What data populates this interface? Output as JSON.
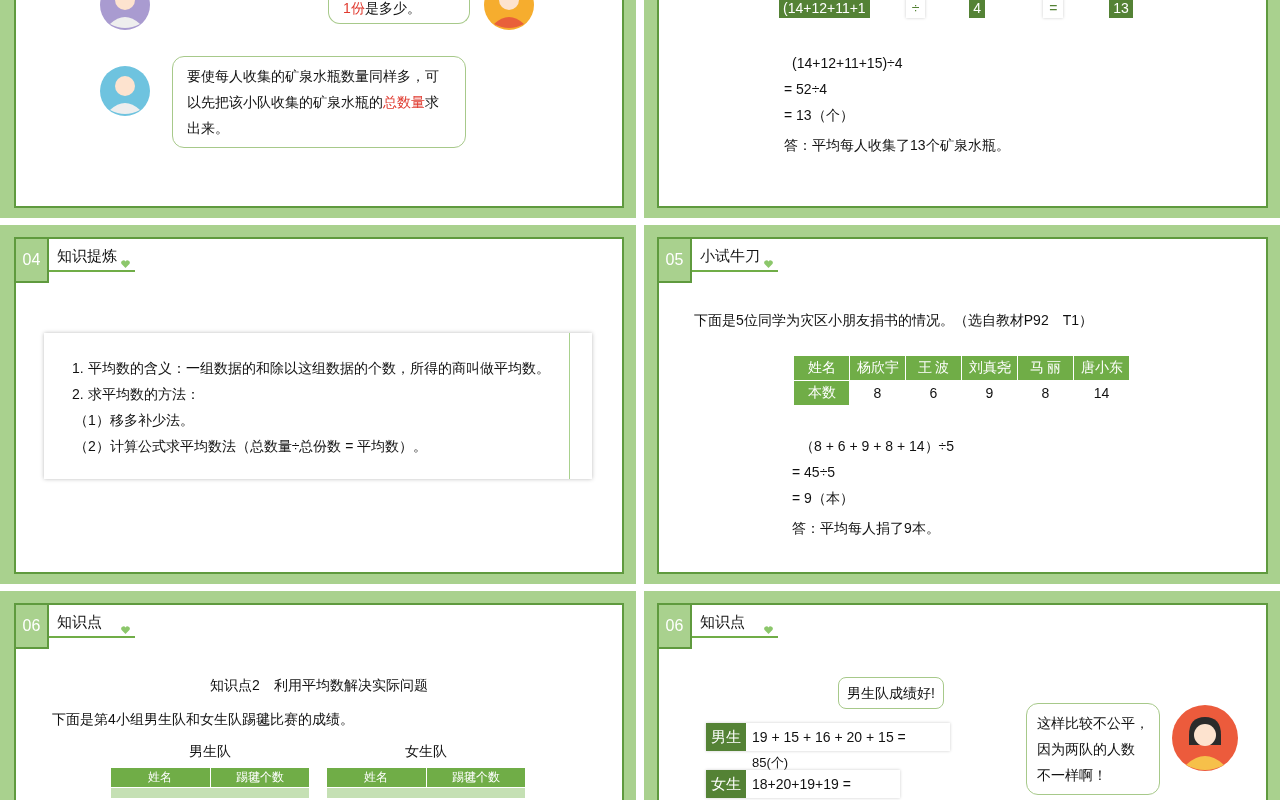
{
  "slides": [
    {
      "kind": "dialogue",
      "rows": [
        {
          "avatars": [
            {
              "kind": "girl-purple"
            },
            {
              "kind": "girl-orange"
            }
          ],
          "bubble": [
            {
              "text": "1份",
              "highlight": true
            },
            {
              "text": "是多少。",
              "highlight": false
            }
          ]
        },
        {
          "avatars": [
            {
              "kind": "boy-blue"
            }
          ],
          "bubble": [
            {
              "text": "要使每人收集的矿泉水瓶数量同样多，可以先把该小队收集的矿泉水瓶的",
              "highlight": false
            },
            {
              "text": "总数量",
              "highlight": true
            },
            {
              "text": "求出来。",
              "highlight": false
            }
          ]
        }
      ]
    },
    {
      "kind": "calculation",
      "blocks": [
        {
          "text": "(14+12+11+1",
          "kind": "filled"
        },
        {
          "text": "÷",
          "kind": "plain"
        },
        {
          "text": "4",
          "kind": "filled"
        },
        {
          "text": "=",
          "kind": "plain"
        },
        {
          "text": "13",
          "kind": "filled"
        }
      ],
      "lines": [
        "(14+12+11+15)÷4",
        "=  52÷4",
        "=  13（个）"
      ],
      "answer": "答：平均每人收集了13个矿泉水瓶。"
    },
    {
      "kind": "summary",
      "number": "04",
      "title": "知识提炼",
      "lines": [
        "1. 平均数的含义：一组数据的和除以这组数据的个数，所得的商叫做平均数。",
        "2. 求平均数的方法：",
        "（1）移多补少法。",
        "（2）计算公式求平均数法（总数量÷总份数 = 平均数）。"
      ]
    },
    {
      "kind": "exercise",
      "number": "05",
      "title": "小试牛刀",
      "intro": "下面是5位同学为灾区小朋友捐书的情况。（选自教材P92　T1）",
      "table": {
        "header_label": "姓名",
        "names": [
          "杨欣宇",
          "王  波",
          "刘真尧",
          "马  丽",
          "唐小东"
        ],
        "row_label": "本数",
        "values": [
          "8",
          "6",
          "9",
          "8",
          "14"
        ]
      },
      "lines": [
        "（8 + 6 + 9 + 8 + 14）÷5",
        "=  45÷5",
        "=  9（本）"
      ],
      "answer": "答：平均每人捐了9本。"
    },
    {
      "kind": "tables",
      "number": "06",
      "title": "知识点",
      "subtitle": "知识点2　利用平均数解决实际问题",
      "intro": "下面是第4小组男生队和女生队踢毽比赛的成绩。",
      "tables": [
        {
          "caption": "男生队",
          "columns": [
            "姓名",
            "踢毽个数"
          ]
        },
        {
          "caption": "女生队",
          "columns": [
            "姓名",
            "踢毽个数"
          ]
        }
      ]
    },
    {
      "kind": "comparison",
      "number": "06",
      "title": "知识点",
      "claim": "男生队成绩好!",
      "rows": [
        {
          "label": "男生",
          "formula": "19 + 15 + 16 + 20 + 15 =",
          "result": "85(个)"
        },
        {
          "label": "女生",
          "formula": "18+20+19+19 ="
        }
      ],
      "reply": [
        "这样比较不公平，",
        "因为两队的人数",
        "不一样啊！"
      ]
    }
  ]
}
